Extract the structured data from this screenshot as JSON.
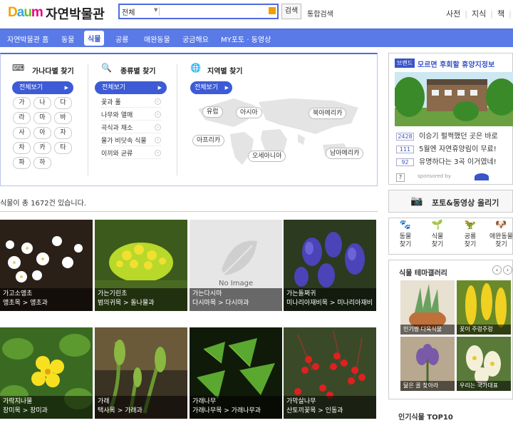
{
  "header": {
    "logo_text": "Daum",
    "title": "자연박물관",
    "search_scope": "전체",
    "search_placeholder": "",
    "search_button": "검색",
    "integrated_search": "통합검색",
    "top_links": [
      "사전",
      "지식",
      "책",
      "카"
    ]
  },
  "nav": {
    "items": [
      "자연박물관 홈",
      "동물",
      "식물",
      "공룡",
      "애완동물",
      "궁금해요",
      "MY포토 · 동영상"
    ],
    "active": "식물"
  },
  "finder": {
    "ganada": {
      "title": "가나다별 찾기",
      "all": "전체보기",
      "letters": [
        "가",
        "나",
        "다",
        "라",
        "마",
        "바",
        "사",
        "아",
        "자",
        "차",
        "카",
        "타",
        "파",
        "하"
      ]
    },
    "species": {
      "title": "종류별 찾기",
      "all": "전체보기",
      "categories": [
        "꽃과 풀",
        "나무와 열매",
        "곡식과 채소",
        "물가 비닷속 식물",
        "이끼와 균류"
      ]
    },
    "region": {
      "title": "지역별 찾기",
      "all": "전체보기",
      "regions": [
        "유럽",
        "아시아",
        "북아메리카",
        "아프리카",
        "오세아니아",
        "남아메리카"
      ]
    }
  },
  "result": {
    "count_text": "식물이 총 1672건 있습니다."
  },
  "plants": [
    {
      "name": "가고소앵초",
      "path": "앵초목 > 앵초과"
    },
    {
      "name": "가는기린초",
      "path": "범의귀목 > 돌나물과"
    },
    {
      "name": "가는다시마",
      "path": "다시마목 > 다시마과",
      "no_image": "No Image"
    },
    {
      "name": "가는돌쩌귀",
      "path": "미나리아재비목 > 미나리아재비"
    },
    {
      "name": "가락지나물",
      "path": "장미목 > 장미과"
    },
    {
      "name": "가래",
      "path": "택사목 > 가래과"
    },
    {
      "name": "가래나무",
      "path": "가래나무목 > 가래나무과"
    },
    {
      "name": "가막살나무",
      "path": "산토끼꽃목 > 인동과"
    }
  ],
  "sidebar": {
    "ad": {
      "badge": "브랜드",
      "title": "모르면 후회할 휴양지정보",
      "rows": [
        {
          "num": "2428",
          "text": "이승기 펄쩍했던 곳은 바로"
        },
        {
          "num": "111",
          "text": "5월엔 자연휴양림이 무료!"
        },
        {
          "num": "92",
          "text": "유명하다는 3곡 이거였네!"
        }
      ],
      "help": "?",
      "sponsored": "sponsored by"
    },
    "upload": "포토&동영상 올리기",
    "quick": [
      {
        "label1": "동물",
        "label2": "찾기"
      },
      {
        "label1": "식물",
        "label2": "찾기"
      },
      {
        "label1": "공룡",
        "label2": "찾기"
      },
      {
        "label1": "애완동물",
        "label2": "찾기"
      }
    ],
    "gallery": {
      "title": "식물 테마갤러리",
      "prev": "‹",
      "next": "›",
      "items": [
        "인기짱 다육식물",
        "꽃이 주렁주렁",
        "닮은 꼴 찾아라",
        "우리는 국가대표"
      ]
    },
    "top10": "인기식물 TOP10"
  }
}
